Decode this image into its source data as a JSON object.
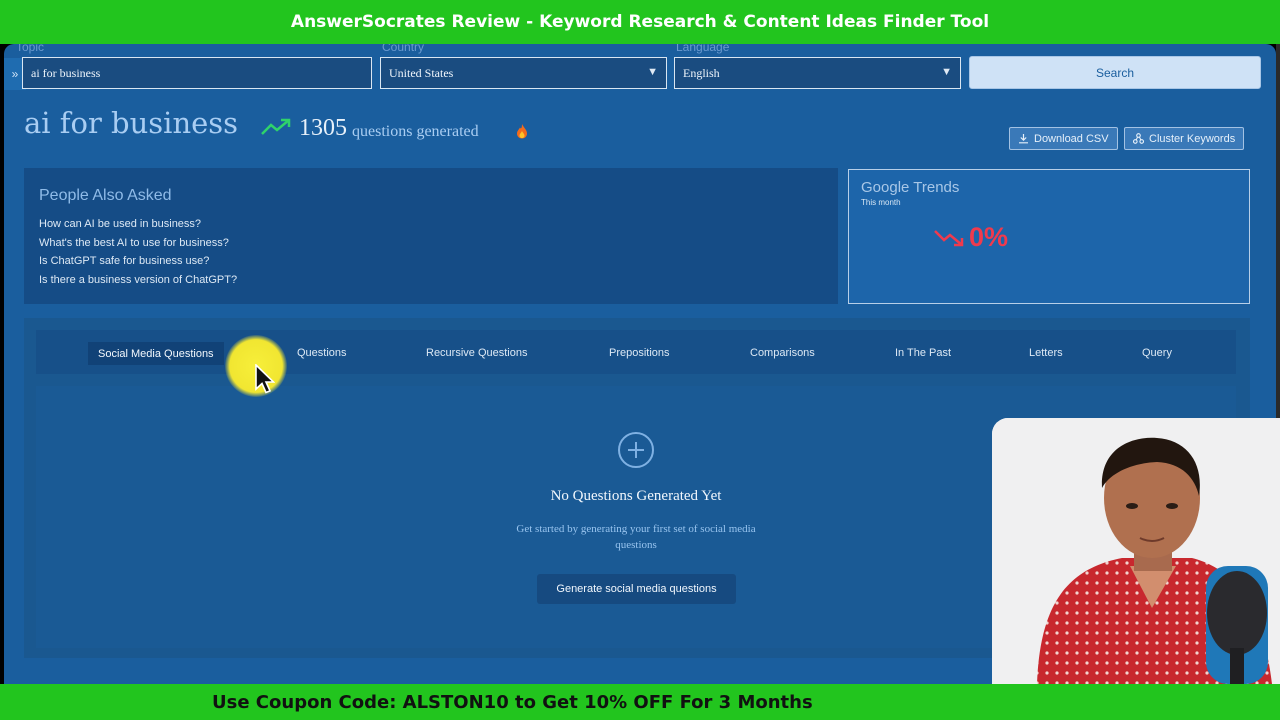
{
  "banner_top": "AnswerSocrates Review - Keyword Research & Content Ideas Finder Tool",
  "banner_bottom": "Use Coupon Code: ALSTON10 to Get 10% OFF For 3 Months",
  "form": {
    "topic_label": "Topic",
    "topic_value": "ai for business",
    "country_label": "Country",
    "country_value": "United States",
    "language_label": "Language",
    "language_value": "English",
    "search_label": "Search"
  },
  "result": {
    "keyword": "ai for business",
    "count": "1305",
    "count_suffix": "questions generated",
    "download_csv": "Download CSV",
    "cluster_keywords": "Cluster Keywords"
  },
  "people_also_asked": {
    "heading": "People Also Asked",
    "questions": [
      "How can AI be used in business?",
      "What's the best AI to use for business?",
      "Is ChatGPT safe for business use?",
      "Is there a business version of ChatGPT?"
    ]
  },
  "google_trends": {
    "title": "Google Trends",
    "period": "This month",
    "value": "0%",
    "direction": "down"
  },
  "tabs": [
    {
      "label": "Social Media Questions",
      "active": true
    },
    {
      "label": "Questions",
      "active": false
    },
    {
      "label": "Recursive Questions",
      "active": false
    },
    {
      "label": "Prepositions",
      "active": false
    },
    {
      "label": "Comparisons",
      "active": false
    },
    {
      "label": "In The Past",
      "active": false
    },
    {
      "label": "Letters",
      "active": false
    },
    {
      "label": "Query",
      "active": false
    }
  ],
  "empty_state": {
    "title": "No Questions Generated Yet",
    "description": "Get started by generating your first set of social media questions",
    "button": "Generate social media questions"
  },
  "colors": {
    "banner": "#22c51e",
    "app_bg": "#1a5e9e",
    "trend_down": "#f03a4d",
    "trend_up": "#2fd36b",
    "cursor_highlight": "#f1e631"
  }
}
